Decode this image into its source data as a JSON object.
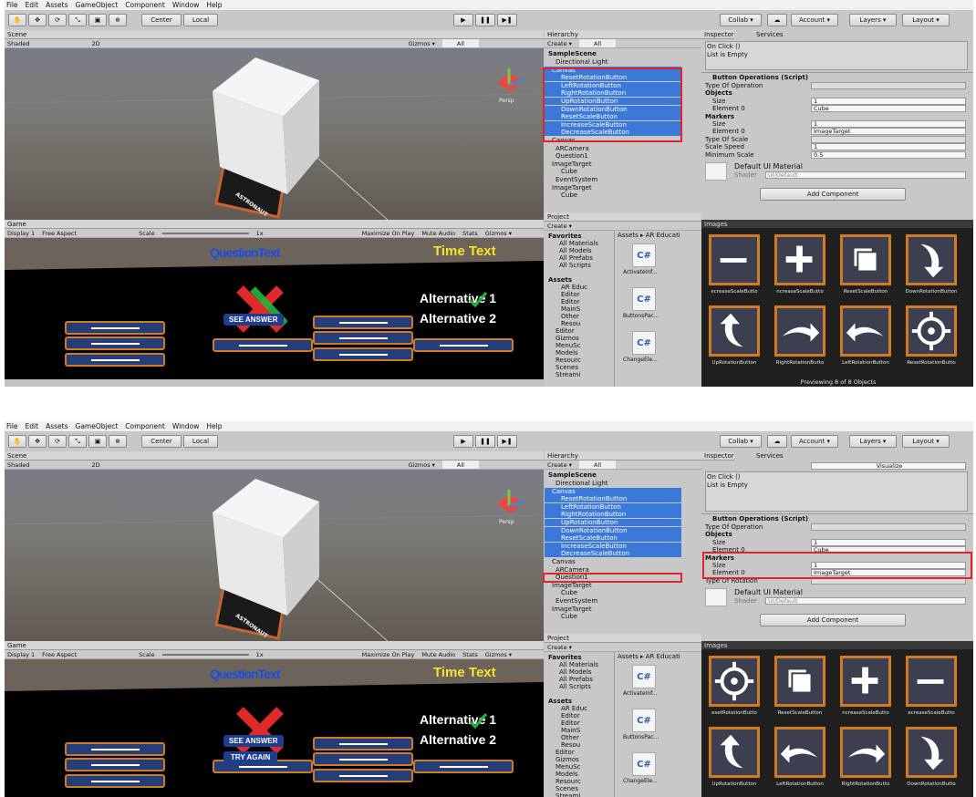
{
  "menu": [
    "File",
    "Edit",
    "Assets",
    "GameObject",
    "Component",
    "Window",
    "Help"
  ],
  "toolbar": {
    "center": "Center",
    "local": "Local",
    "collab": "Collab ▾",
    "account": "Account ▾",
    "layers": "Layers ▾",
    "layout": "Layout ▾"
  },
  "scene": {
    "tab": "Scene",
    "shaded": "Shaded",
    "mode2d": "2D",
    "gizmos": "Gizmos ▾",
    "search": "All",
    "persp": "Persp",
    "marker_text": "ASTRONAUT"
  },
  "game": {
    "tab": "Game",
    "display": "Display 1",
    "aspect": "Free Aspect",
    "scale": "Scale",
    "scale_val": "1x",
    "options": [
      "Maximize On Play",
      "Mute Audio",
      "Stats",
      "Gizmos ▾"
    ],
    "question_text": "QuestionText",
    "time_text": "Time Text",
    "alternative1": "Alternative 1",
    "alternative2": "Alternative 2",
    "see_answer": "SEE ANSWER",
    "try_again": "TRY AGAIN"
  },
  "hierarchy": {
    "tab": "Hierarchy",
    "create": "Create ▾",
    "search": "All",
    "scene_name": "SampleScene",
    "rows": [
      "Directional Light",
      "Canvas",
      "ResetRotationButton",
      "LeftRotationButton",
      "RightRotationButton",
      "UpRotationButton",
      "DownRotationButton",
      "ResetScaleButton",
      "IncreaseScaleButton",
      "DecreaseScaleButton",
      "Canvas",
      "ARCamera",
      "Question1",
      "ImageTarget",
      "Cube",
      "EventSystem",
      "ImageTarget",
      "Cube"
    ]
  },
  "project": {
    "tab": "Project",
    "create": "Create ▾",
    "favorites": "Favorites",
    "fav_items": [
      "All Materials",
      "All Models",
      "All Prefabs",
      "All Scripts"
    ],
    "assets": "Assets",
    "tree": [
      "AR Educ",
      "Editor",
      "Editor",
      "MainS",
      "Other",
      "Resou",
      "Editor",
      "Gizmos",
      "MenuSc",
      "Models",
      "Resourc",
      "Scenes",
      "Streami"
    ],
    "breadcrumb": "Assets ▸ AR Educati",
    "files": [
      "ActivateInf...",
      "ButtonsPac...",
      "ChangeEle..."
    ]
  },
  "inspector": {
    "tab": "Inspector",
    "services": "Services",
    "on_click": "On Click ()",
    "list_empty": "List is Empty",
    "visualize": "Visualize",
    "script": "Button Operations (Script)",
    "type_of_operation": "Type Of Operation",
    "objects": "Objects",
    "size": "Size",
    "size_val": "1",
    "element0": "Element 0",
    "cube": "Cube",
    "markers": "Markers",
    "image_target": "ImageTarget",
    "type_of_scale": "Type Of Scale",
    "scale_speed": "Scale Speed",
    "scale_speed_val": "1",
    "minimum_scale": "Minimum Scale",
    "minimum_scale_val": "0.5",
    "type_of_rotation": "Type Of Rotation",
    "material": "Default UI Material",
    "shader": "Shader",
    "shader_val": "UI/Default",
    "add_component": "Add Component"
  },
  "images": {
    "tab": "Images",
    "top_captions": [
      "ecreaseScaleButto",
      "ncreaseScaleButto",
      "ResetScaleButton",
      "DownRotationButton"
    ],
    "bottom_captions": [
      "UpRotationButton",
      "RightRotationButto",
      "LeftRotationButton",
      "ResetRotationButto"
    ],
    "top_captions_2": [
      "esetRotationButto",
      "ResetScaleButton",
      "ncreaseScaleButto",
      "ecreaseScaleButto"
    ],
    "bottom_captions_2": [
      "UpRotationButton",
      "LeftRotationButton",
      "RightRotationButto",
      "DownRotationButto"
    ],
    "footer": "Previewing 8 of 8 Objects"
  }
}
